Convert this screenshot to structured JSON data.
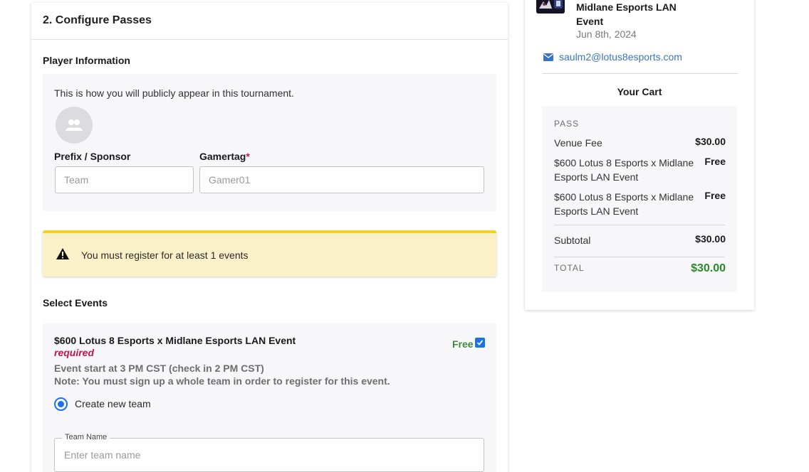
{
  "main": {
    "section_title": "2. Configure Passes",
    "player_info": {
      "heading": "Player Information",
      "description": "This is how you will publicly appear in this tournament.",
      "prefix_label": "Prefix / Sponsor",
      "prefix_placeholder": "Team",
      "gamertag_label": "Gamertag",
      "gamertag_required_mark": "*",
      "gamertag_placeholder": "Gamer01"
    },
    "warning": {
      "icon": "warning-triangle-icon",
      "text": "You must register for at least 1 events"
    },
    "select_events": {
      "heading": "Select Events",
      "event": {
        "title": "$600 Lotus 8 Esports x Midlane Esports LAN Event",
        "required": "required",
        "start_line": "Event start at 3 PM CST (check in 2 PM CST)",
        "note_line": "Note: You must sign up a whole team in order to register for this event.",
        "price": "Free",
        "checked": true,
        "radio_label": "Create new team",
        "team_name_legend": "Team Name",
        "team_name_placeholder": "Enter team name"
      }
    }
  },
  "sidebar": {
    "event_name": "Midlane Esports LAN Event",
    "event_date": "Jun 8th, 2024",
    "email": "saulm2@lotus8esports.com",
    "cart": {
      "title": "Your Cart",
      "pass_label": "PASS",
      "items": [
        {
          "name": "Venue Fee",
          "price": "$30.00"
        },
        {
          "name": "$600 Lotus 8 Esports x Midlane Esports LAN Event",
          "price": "Free"
        },
        {
          "name": "$600 Lotus 8 Esports x Midlane Esports LAN Event",
          "price": "Free"
        }
      ],
      "subtotal_label": "Subtotal",
      "subtotal_value": "$30.00",
      "total_label": "TOTAL",
      "total_value": "$30.00"
    }
  },
  "colors": {
    "accent": "#1a73e8",
    "required": "#c3174b",
    "warning_bg": "#fbf1c8",
    "warning_border": "#f4d31c",
    "total_green": "#2a8a2a",
    "link_blue": "#3b74c4"
  }
}
